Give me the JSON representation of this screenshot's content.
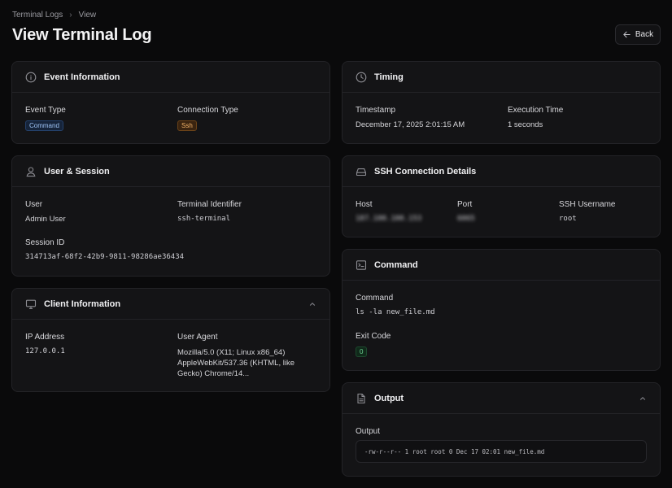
{
  "breadcrumb": {
    "root": "Terminal Logs",
    "current": "View"
  },
  "page": {
    "title": "View Terminal Log",
    "back_label": "Back"
  },
  "event": {
    "title": "Event Information",
    "event_type_label": "Event Type",
    "event_type": "Command",
    "connection_type_label": "Connection Type",
    "connection_type": "Ssh"
  },
  "user": {
    "title": "User & Session",
    "user_label": "User",
    "user": "Admin User",
    "terminal_label": "Terminal Identifier",
    "terminal": "ssh-terminal",
    "session_label": "Session ID",
    "session": "314713af-68f2-42b9-9811-98286ae36434"
  },
  "client": {
    "title": "Client Information",
    "ip_label": "IP Address",
    "ip": "127.0.0.1",
    "ua_label": "User Agent",
    "ua": "Mozilla/5.0 (X11; Linux x86_64) AppleWebKit/537.36 (KHTML, like Gecko) Chrome/14..."
  },
  "timing": {
    "title": "Timing",
    "timestamp_label": "Timestamp",
    "timestamp": "December 17, 2025 2:01:15 AM",
    "exec_label": "Execution Time",
    "exec": "1 seconds"
  },
  "ssh": {
    "title": "SSH Connection Details",
    "host_label": "Host",
    "host": "187.100.100.153",
    "port_label": "Port",
    "port": "6065",
    "username_label": "SSH Username",
    "username": "root"
  },
  "command": {
    "title": "Command",
    "command_label": "Command",
    "command": "ls -la new_file.md",
    "exit_label": "Exit Code",
    "exit": "0"
  },
  "output": {
    "title": "Output",
    "output_label": "Output",
    "output": "-rw-r--r-- 1 root root 0 Dec 17 02:01 new_file.md"
  },
  "icons": {
    "info": "info-icon",
    "user": "user-icon",
    "monitor": "monitor-icon",
    "clock": "clock-icon",
    "drive": "server-icon",
    "terminal": "terminal-icon",
    "file": "file-icon",
    "chevron": "chevron-up-icon",
    "arrow": "arrow-left-icon"
  }
}
